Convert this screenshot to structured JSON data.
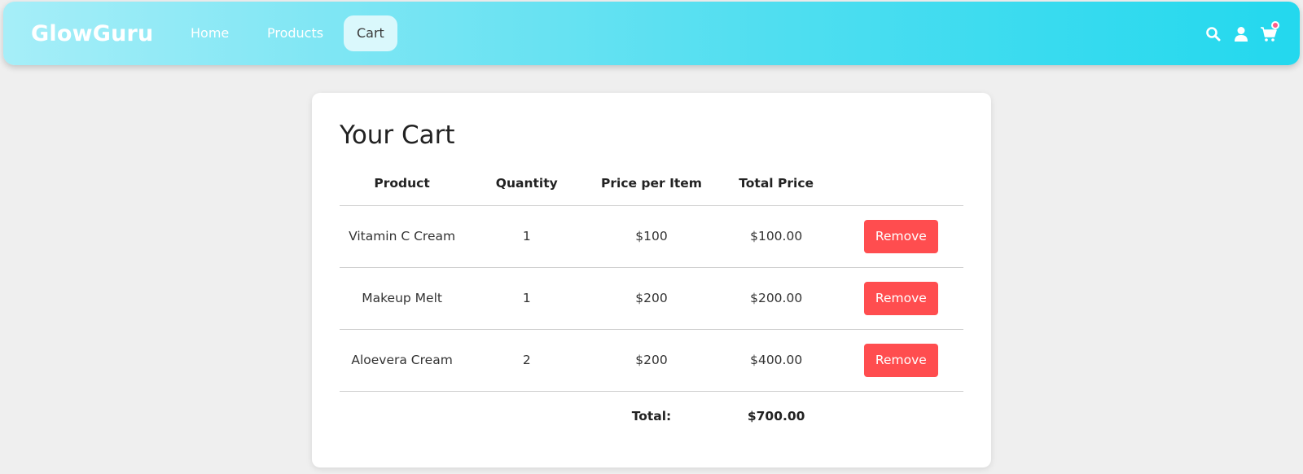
{
  "brand": "GlowGuru",
  "nav": {
    "home": "Home",
    "products": "Products",
    "cart": "Cart",
    "active": "Cart"
  },
  "header_icons": [
    "search-icon",
    "user-icon",
    "cart-icon"
  ],
  "colors": {
    "navbar_start": "#a6eef8",
    "navbar_end": "#23d8ee",
    "remove_button": "#ff4d4f",
    "badge": "#ff5b8a",
    "page_background": "#efefef"
  },
  "cart": {
    "title": "Your Cart",
    "columns": [
      "Product",
      "Quantity",
      "Price per Item",
      "Total Price",
      ""
    ],
    "items": [
      {
        "product": "Vitamin C Cream",
        "quantity": "1",
        "price": "$100",
        "total": "$100.00",
        "action": "Remove"
      },
      {
        "product": "Makeup Melt",
        "quantity": "1",
        "price": "$200",
        "total": "$200.00",
        "action": "Remove"
      },
      {
        "product": "Aloevera Cream",
        "quantity": "2",
        "price": "$200",
        "total": "$400.00",
        "action": "Remove"
      }
    ],
    "total_label": "Total:",
    "total_value": "$700.00"
  }
}
